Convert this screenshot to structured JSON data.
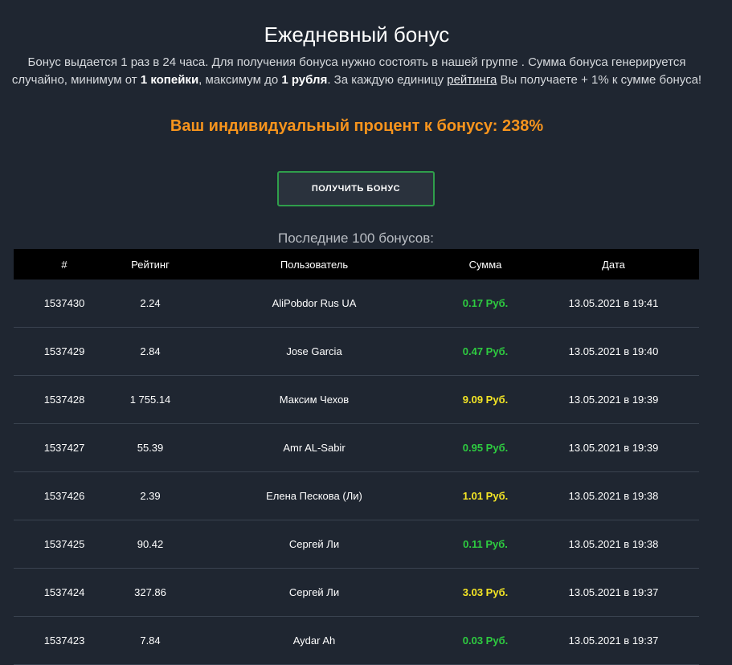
{
  "page": {
    "title": "Ежедневный бонус",
    "desc": {
      "p1": "Бонус выдается 1 раз в 24 часа. Для получения бонуса нужно состоять в нашей группе . Сумма бонуса генерируется случайно, минимум от ",
      "b1": "1 копейки",
      "p2": ", максимум до ",
      "b2": "1 рубля",
      "p3": ". За каждую единицу ",
      "link": "рейтинга",
      "p4": " Вы получаете + 1% к сумме бонуса!"
    },
    "percent_text": "Ваш индивидуальный процент к бонусу: 238%",
    "button_label": "ПОЛУЧИТЬ БОНУС",
    "list_title": "Последние 100 бонусов:"
  },
  "colors": {
    "accent": "#f7941d",
    "green": "#2ecc40",
    "yellow": "#f5e625",
    "background": "#1f2631"
  },
  "table": {
    "headers": {
      "id": "#",
      "rating": "Рейтинг",
      "user": "Пользователь",
      "amount": "Сумма",
      "date": "Дата"
    },
    "rows": [
      {
        "id": "1537430",
        "rating": "2.24",
        "user": "AliPobdor Rus UA",
        "amount": "0.17 Руб.",
        "color": "green",
        "date": "13.05.2021 в 19:41"
      },
      {
        "id": "1537429",
        "rating": "2.84",
        "user": "Jose Garcia",
        "amount": "0.47 Руб.",
        "color": "green",
        "date": "13.05.2021 в 19:40"
      },
      {
        "id": "1537428",
        "rating": "1 755.14",
        "user": "Максим Чехов",
        "amount": "9.09 Руб.",
        "color": "yellow",
        "date": "13.05.2021 в 19:39"
      },
      {
        "id": "1537427",
        "rating": "55.39",
        "user": "Amr AL-Sabir",
        "amount": "0.95 Руб.",
        "color": "green",
        "date": "13.05.2021 в 19:39"
      },
      {
        "id": "1537426",
        "rating": "2.39",
        "user": "Елена Пескова (Ли)",
        "amount": "1.01 Руб.",
        "color": "yellow",
        "date": "13.05.2021 в 19:38"
      },
      {
        "id": "1537425",
        "rating": "90.42",
        "user": "Сергей Ли",
        "amount": "0.11 Руб.",
        "color": "green",
        "date": "13.05.2021 в 19:38"
      },
      {
        "id": "1537424",
        "rating": "327.86",
        "user": "Сергей Ли",
        "amount": "3.03 Руб.",
        "color": "yellow",
        "date": "13.05.2021 в 19:37"
      },
      {
        "id": "1537423",
        "rating": "7.84",
        "user": "Aydar Ah",
        "amount": "0.03 Руб.",
        "color": "green",
        "date": "13.05.2021 в 19:37"
      }
    ]
  }
}
